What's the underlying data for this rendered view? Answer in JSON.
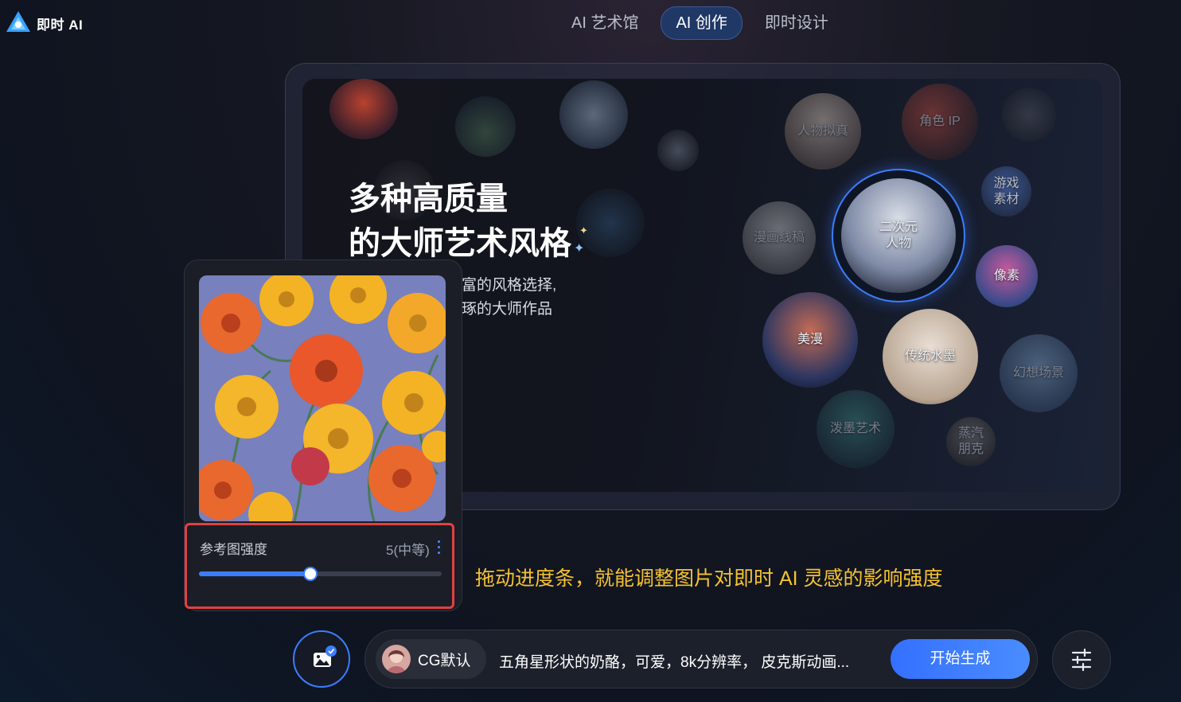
{
  "logo": {
    "text": "即时 AI"
  },
  "nav": {
    "tabs": [
      "AI 艺术馆",
      "AI 创作",
      "即时设计"
    ],
    "active_index": 1
  },
  "hero": {
    "headline_line1": "多种高质量",
    "headline_line2": "的大师艺术风格",
    "subline_line1": "富的风格选择,",
    "subline_line2": "琢的大师作品",
    "styles": {
      "realistic": "人物拟真",
      "character_ip": "角色 IP",
      "game_assets": "游戏\n素材",
      "manga_line": "漫画线稿",
      "anime": "二次元\n人物",
      "pixel": "像素",
      "american_comic": "美漫",
      "ink": "传统水墨",
      "fantasy": "幻想场景",
      "splash_ink": "泼墨艺术",
      "steampunk": "蒸汽\n朋克"
    }
  },
  "reference": {
    "label": "参考图强度",
    "value_text": "5(中等)",
    "strength_fraction": 0.46
  },
  "hint_text": "拖动进度条，就能调整图片对即时 AI 灵感的影响强度",
  "prompt": {
    "style_chip": "CG默认",
    "text": "五角星形状的奶酪，可爱，8k分辨率， 皮克斯动画...",
    "generate_label": "开始生成"
  },
  "colors": {
    "accent": "#3c7dff",
    "hint": "#f5c230",
    "highlight_box": "#e1413f"
  }
}
